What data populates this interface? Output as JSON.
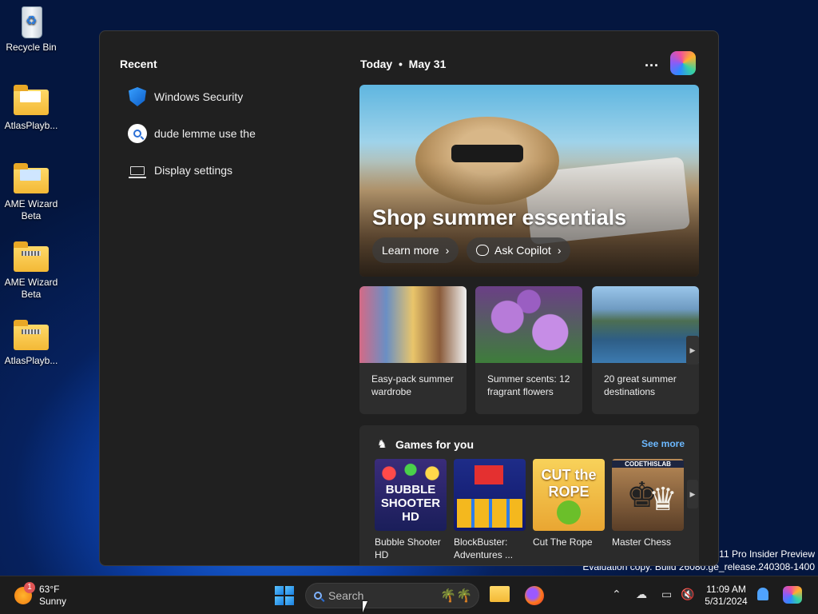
{
  "desktop": {
    "icons": [
      {
        "label": "Recycle Bin"
      },
      {
        "label": "AtlasPlayb..."
      },
      {
        "label": "AME Wizard Beta"
      },
      {
        "label": "AME Wizard Beta"
      },
      {
        "label": "AtlasPlayb..."
      }
    ],
    "watermark": {
      "line1": "s 11 Pro Insider Preview",
      "line2": "Evaluation copy. Build 26080.ge_release.240308-1400"
    }
  },
  "start": {
    "recent_title": "Recent",
    "recent": [
      {
        "label": "Windows Security",
        "icon": "shield-icon"
      },
      {
        "label": "dude lemme use the",
        "icon": "search-icon"
      },
      {
        "label": "Display settings",
        "icon": "laptop-icon"
      }
    ],
    "today_label": "Today",
    "date": "May 31",
    "more_label": "...",
    "hero": {
      "title": "Shop summer essentials",
      "learn_more": "Learn more",
      "ask_copilot": "Ask Copilot"
    },
    "cards": [
      {
        "caption": "Easy-pack summer wardrobe"
      },
      {
        "caption": "Summer scents: 12 fragrant flowers"
      },
      {
        "caption": "20 great summer destinations"
      }
    ],
    "games": {
      "title": "Games for you",
      "see_more": "See more",
      "items": [
        {
          "name": "Bubble Shooter HD",
          "art": "BUBBLE SHOOTER HD"
        },
        {
          "name": "BlockBuster: Adventures ...",
          "art": ""
        },
        {
          "name": "Cut The Rope",
          "art": "CUT the ROPE"
        },
        {
          "name": "Master Chess",
          "art": "CODETHISLAB"
        }
      ]
    }
  },
  "taskbar": {
    "weather": {
      "temp": "63°F",
      "condition": "Sunny",
      "badge": "1"
    },
    "search_placeholder": "Search",
    "clock": {
      "time": "11:09 AM",
      "date": "5/31/2024"
    }
  },
  "colors": {
    "accent": "#6cb8ff",
    "panel": "#202020",
    "taskbar": "#1c1c1c"
  }
}
